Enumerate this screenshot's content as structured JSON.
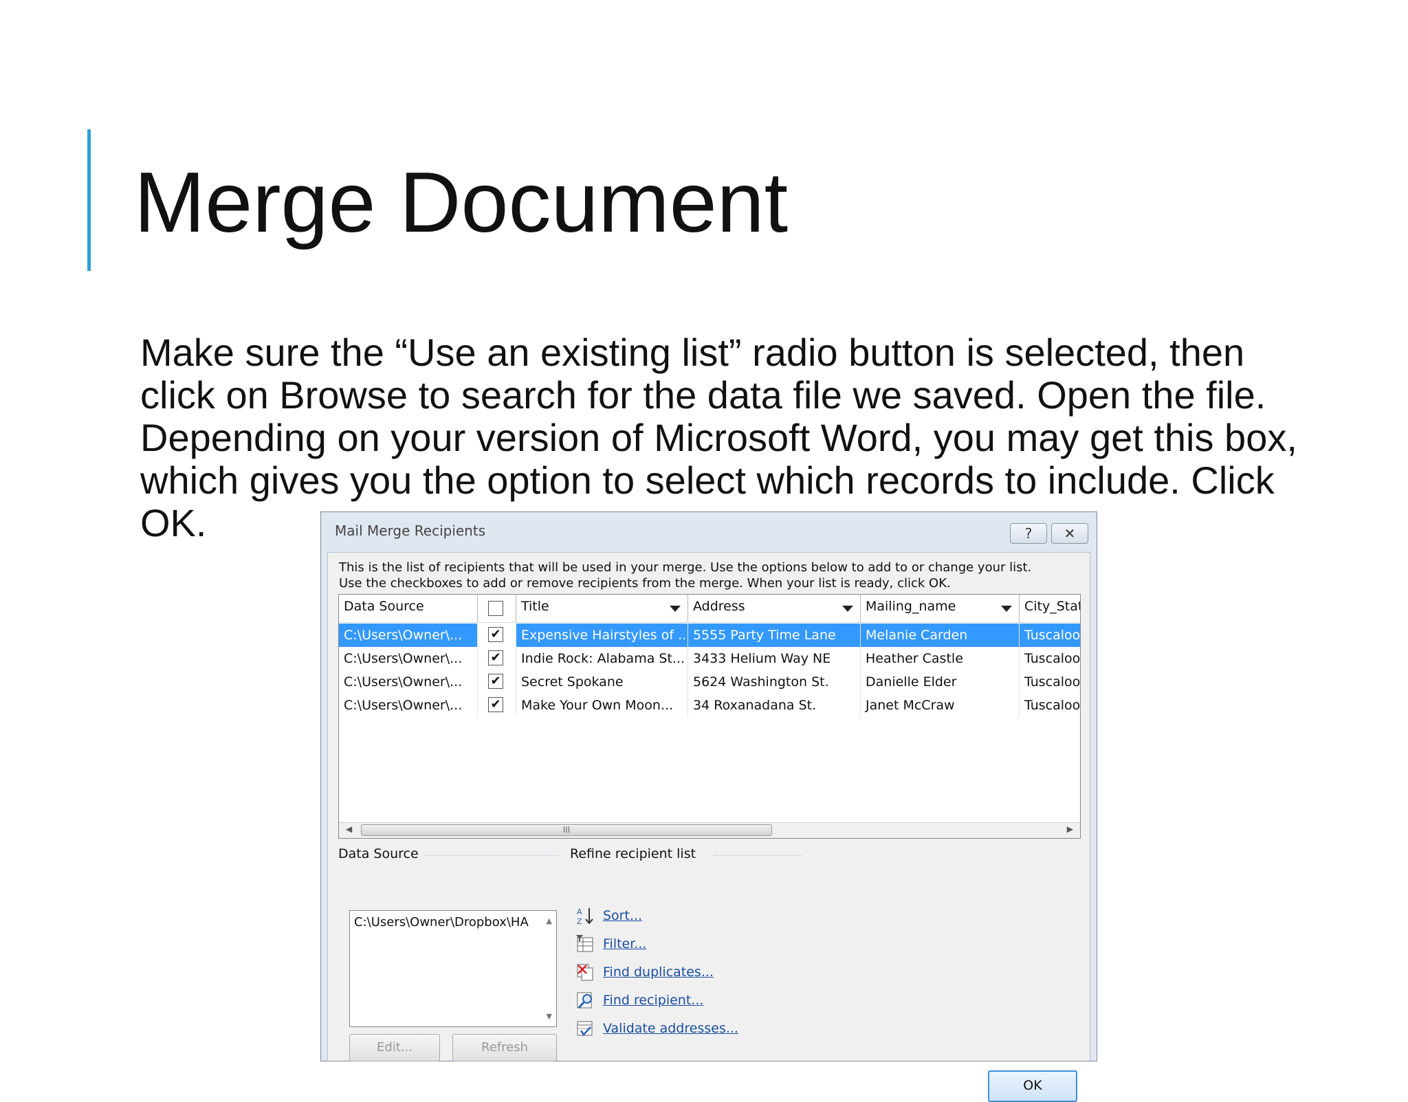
{
  "slide": {
    "title": "Merge Document",
    "body_lines": [
      "Make sure the “Use an existing list” radio button is selected, then",
      "click on Browse to search for the data file we saved. Open the file.",
      "Depending on your version of Microsoft Word, you may get this box,",
      "which gives you the option to select which records to include. Click",
      "OK."
    ],
    "accent_color": "#2d9fd8"
  },
  "dialog": {
    "title": "Mail Merge Recipients",
    "help_icon": "?",
    "close_icon": "✕",
    "intro_lines": [
      "This is the list of recipients that will be used in your merge.  Use the options below to add to or change your list.",
      "Use the checkboxes to add or remove recipients from the merge.  When your list is ready, click OK."
    ],
    "columns": [
      "Data Source",
      "",
      "Title",
      "Address",
      "Mailing_name",
      "City_State"
    ],
    "rows": [
      {
        "source": "C:\\Users\\Owner\\...",
        "checked": "✔",
        "title": "Expensive Hairstyles of ...",
        "address": "5555 Party Time Lane",
        "name": "Melanie Carden",
        "city": "Tuscaloosa",
        "selected": true
      },
      {
        "source": "C:\\Users\\Owner\\...",
        "checked": "✔",
        "title": "Indie Rock: Alabama St...",
        "address": "3433 Helium Way NE",
        "name": "Heather Castle",
        "city": "Tuscaloosa",
        "selected": false
      },
      {
        "source": "C:\\Users\\Owner\\...",
        "checked": "✔",
        "title": "Secret Spokane",
        "address": "5624 Washington St.",
        "name": "Danielle Elder",
        "city": "Tuscaloosa",
        "selected": false
      },
      {
        "source": "C:\\Users\\Owner\\...",
        "checked": "✔",
        "title": "Make Your Own Moon...",
        "address": "34 Roxanadana St.",
        "name": "Janet McCraw",
        "city": "Tuscaloosa",
        "selected": false
      }
    ],
    "scroll_grip": "III",
    "data_source_label": "Data Source",
    "data_source_value": "C:\\Users\\Owner\\Dropbox\\HA",
    "edit_label": "Edit...",
    "refresh_label": "Refresh",
    "refine_label": "Refine recipient list",
    "refine_links": [
      "Sort...",
      "Filter...",
      "Find duplicates...",
      "Find recipient...",
      "Validate addresses..."
    ],
    "ok_label": "OK",
    "selection_color": "#3399ff",
    "link_color": "#1a4ea0"
  }
}
